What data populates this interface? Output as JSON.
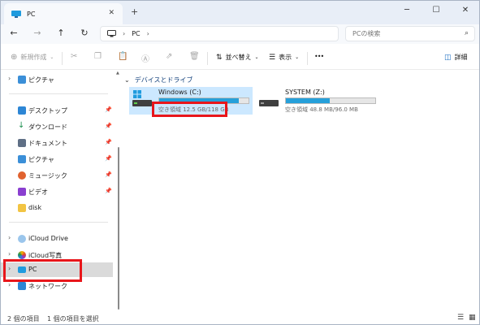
{
  "tab": {
    "title": "PC",
    "close": "✕",
    "new_tab": "+"
  },
  "window_controls": {
    "minimize": "─",
    "maximize": "☐",
    "close": "✕"
  },
  "nav": {
    "back": "←",
    "forward": "→",
    "up": "↑",
    "refresh": "↻"
  },
  "address": {
    "segment": "PC",
    "chevron1": "›",
    "chevron2": "›"
  },
  "search": {
    "placeholder": "PCの検索"
  },
  "toolbar": {
    "new_label": "新規作成",
    "sort_label": "並べ替え",
    "view_label": "表示",
    "more_label": "•••",
    "details_label": "詳細"
  },
  "sidebar": {
    "items": [
      {
        "label": "ピクチャ"
      },
      {
        "label": "デスクトップ"
      },
      {
        "label": "ダウンロード"
      },
      {
        "label": "ドキュメント"
      },
      {
        "label": "ピクチャ"
      },
      {
        "label": "ミュージック"
      },
      {
        "label": "ビデオ"
      },
      {
        "label": "disk"
      },
      {
        "label": "iCloud Drive"
      },
      {
        "label": "iCloud写真"
      },
      {
        "label": "PC"
      },
      {
        "label": "ネットワーク"
      }
    ]
  },
  "content": {
    "group_header": "デバイスとドライブ",
    "drives": [
      {
        "name": "Windows (C:)",
        "free_text": "空き領域 12.5 GB/118 GB",
        "used_fraction": 0.894
      },
      {
        "name": "SYSTEM (Z:)",
        "free_text": "空き領域 48.8 MB/96.0 MB",
        "used_fraction": 0.49
      }
    ]
  },
  "status": {
    "item_count": "2 個の項目",
    "selected": "1 個の項目を選択"
  },
  "colors": {
    "accent": "#26a0da",
    "highlight": "#e8161b",
    "selected_bg": "#cce8ff"
  }
}
